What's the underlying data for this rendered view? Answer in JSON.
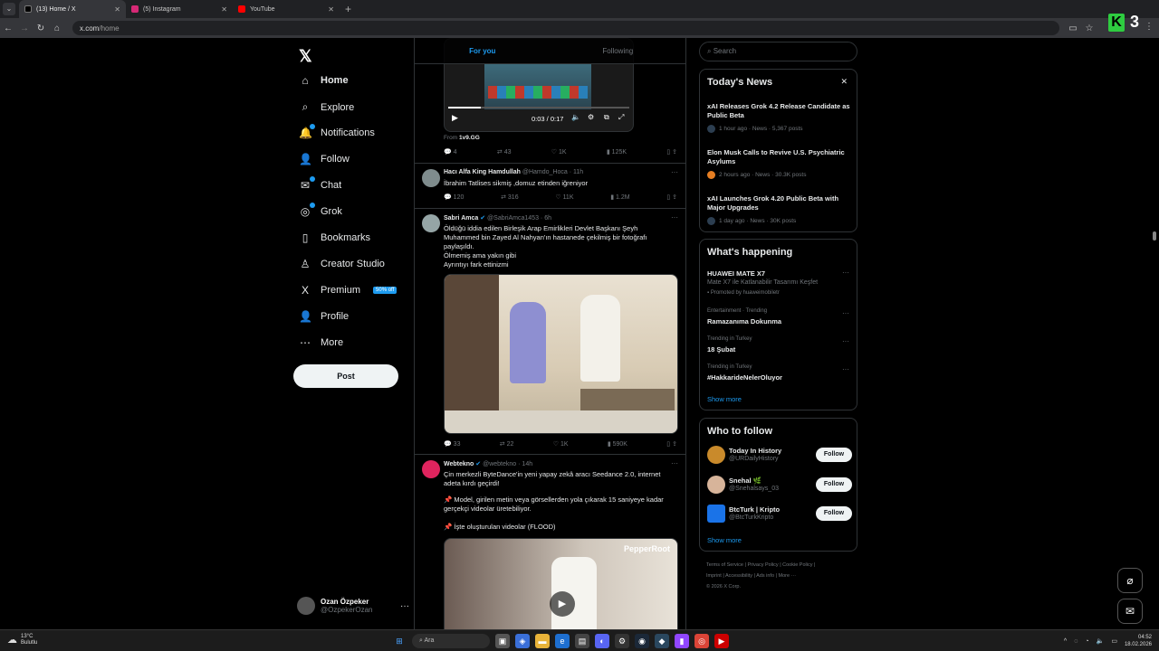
{
  "browser": {
    "tabs": [
      {
        "title": "(13) Home / X",
        "color": "#000000",
        "icon": "x-logo-icon"
      },
      {
        "title": "(5) Instagram",
        "color": "#d62976",
        "icon": "instagram-icon"
      },
      {
        "title": "YouTube",
        "color": "#ff0000",
        "icon": "youtube-icon"
      }
    ],
    "url_host": "x.com",
    "url_path": "/home",
    "badge_letter": "K",
    "badge_number": "3"
  },
  "sidebar": {
    "items": [
      {
        "label": "Home",
        "icon": "home-icon",
        "glyph": "⌂"
      },
      {
        "label": "Explore",
        "icon": "search-icon",
        "glyph": "⌕"
      },
      {
        "label": "Notifications",
        "icon": "bell-icon",
        "glyph": "🔔"
      },
      {
        "label": "Follow",
        "icon": "person-add-icon",
        "glyph": "👤"
      },
      {
        "label": "Chat",
        "icon": "mail-icon",
        "glyph": "✉"
      },
      {
        "label": "Grok",
        "icon": "grok-icon",
        "glyph": "◎"
      },
      {
        "label": "Bookmarks",
        "icon": "bookmark-icon",
        "glyph": "▯"
      },
      {
        "label": "Creator Studio",
        "icon": "creator-studio-icon",
        "glyph": "♙"
      },
      {
        "label": "Premium",
        "icon": "x-premium-icon",
        "glyph": "X"
      },
      {
        "label": "Profile",
        "icon": "person-icon",
        "glyph": "👤"
      },
      {
        "label": "More",
        "icon": "more-circle-icon",
        "glyph": "⋯"
      }
    ],
    "premium_badge": "50% off",
    "post_button": "Post",
    "account_name": "Ozan Özpeker",
    "account_handle": "@OzpekerOzan"
  },
  "feed": {
    "tabs": [
      "For you",
      "Following"
    ],
    "video": {
      "time": "0:03 / 0:17",
      "source_prefix": "From",
      "source": "1v9.GG"
    },
    "post0_actions": [
      "4",
      "43",
      "1K",
      "125K"
    ],
    "posts": [
      {
        "name": "Hacı Alfa King Hamdullah",
        "handle": "@Hamdo_Hoca",
        "time": "11h",
        "text": "İbrahim Tatlises sikmiş ,domuz etinden iğreniyor",
        "actions": [
          "120",
          "316",
          "11K",
          "1.2M"
        ]
      },
      {
        "name": "Sabri Amca",
        "handle": "@SabriAmca1453",
        "time": "6h",
        "text": "Öldüğü iddia edilen Birleşik Arap Emirlikleri Devlet Başkanı Şeyh Muhammed bin Zayed Al Nahyan'ın hastanede çekilmiş bir fotoğrafı paylaşıldı.",
        "text2": "Ölmemiş ama yakın gibi",
        "text3": "Ayrıntıyı fark ettinizmi",
        "actions": [
          "33",
          "22",
          "1K",
          "590K"
        ]
      },
      {
        "name": "Webtekno",
        "handle": "@webtekno",
        "time": "14h",
        "text": "Çin merkezli ByteDance'in yeni yapay zekâ aracı Seedance 2.0, internet adeta kırdı geçirdi!",
        "text2": "📌 Model, girilen metin veya görsellerden yola çıkarak 15 saniyeye kadar gerçekçi videolar üretebiliyor.",
        "text3": "📌 İşte oluşturulan videolar (FLOOD)",
        "watermark": "PepperRoot"
      }
    ]
  },
  "right": {
    "search_placeholder": "Search",
    "news_title": "Today's News",
    "news": [
      {
        "title": "xAI Releases Grok 4.2 Release Candidate as Public Beta",
        "meta": "1 hour ago · News · 5,367 posts"
      },
      {
        "title": "Elon Musk Calls to Revive U.S. Psychiatric Asylums",
        "meta": "2 hours ago · News · 30.3K posts"
      },
      {
        "title": "xAI Launches Grok 4.20 Public Beta with Major Upgrades",
        "meta": "1 day ago · News · 30K posts"
      }
    ],
    "happening_title": "What's happening",
    "trends": [
      {
        "context": "",
        "title": "HUAWEI MATE X7",
        "desc": "Mate X7 ile Katlanabilir Tasarımı Keşfet",
        "promoted": "Promoted by huaweimobiletr"
      },
      {
        "context": "Entertainment · Trending",
        "title": "Ramazanıma Dokunma"
      },
      {
        "context": "Trending in Turkey",
        "title": "18 Şubat"
      },
      {
        "context": "Trending in Turkey",
        "title": "#HakkarideNelerOluyor"
      }
    ],
    "show_more": "Show more",
    "who_title": "Who to follow",
    "who": [
      {
        "name": "Today In History",
        "handle": "@URDailyHistory",
        "button": "Follow",
        "color": "#c98a2b"
      },
      {
        "name": "Snehal 🌿",
        "handle": "@Snehalsays_03",
        "button": "Follow",
        "color": "#d7b49a"
      },
      {
        "name": "BtcTurk | Kripto",
        "handle": "@BtcTurkKripto",
        "button": "Follow",
        "color": "#1a73e8"
      }
    ],
    "footer_line1": "Terms of Service  |  Privacy Policy  |  Cookie Policy  |",
    "footer_line2": "Imprint  |  Accessibility  |  Ads info  |  More ···",
    "footer_line3": "© 2026 X Corp."
  },
  "taskbar": {
    "temp": "13°C",
    "condition": "Bulutlu",
    "search": "Ara",
    "time": "04:52",
    "date": "18.02.2026"
  }
}
